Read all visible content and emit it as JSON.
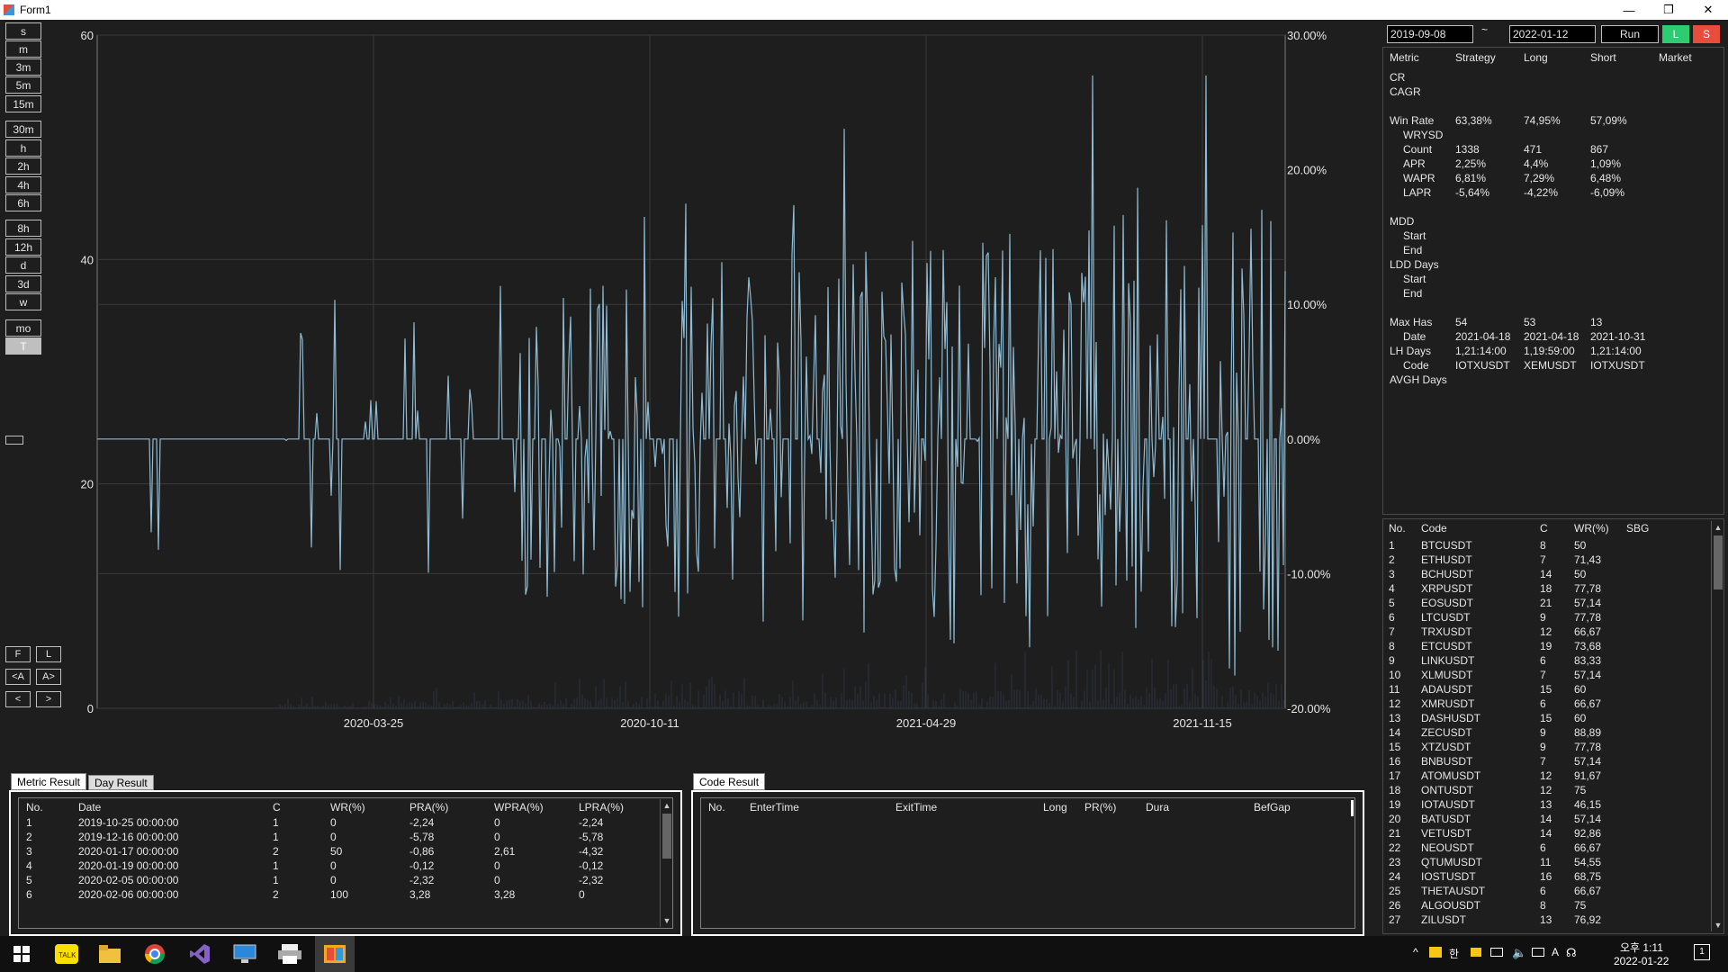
{
  "window": {
    "title": "Form1",
    "min": "—",
    "max": "❐",
    "close": "✕"
  },
  "timeframes": [
    "s",
    "m",
    "3m",
    "5m",
    "15m",
    "30m",
    "h",
    "2h",
    "4h",
    "6h",
    "8h",
    "12h",
    "d",
    "3d",
    "w",
    "mo",
    "T"
  ],
  "nav_buttons": {
    "f": "F",
    "l": "L",
    "prev": "<A",
    "next": "A>",
    "left": "<",
    "right": ">"
  },
  "chart_data": {
    "type": "line",
    "left_axis": {
      "ticks": [
        "60",
        "40",
        "20",
        "0"
      ],
      "ylim": [
        0,
        60
      ]
    },
    "right_axis": {
      "ticks": [
        "30.00%",
        "20.00%",
        "10.00%",
        "0.00%",
        "-10.00%",
        "-20.00%"
      ],
      "ylim": [
        -20,
        30
      ]
    },
    "x_ticks": [
      "2020-03-25",
      "2020-10-11",
      "2021-04-29",
      "2021-11-15"
    ],
    "series": [
      {
        "color": "#8fbcd4"
      }
    ],
    "grid": true
  },
  "controls": {
    "start_date": "2019-09-08",
    "tilde": "~",
    "end_date": "2022-01-12",
    "run": "Run",
    "long": "L",
    "short": "S"
  },
  "metrics": {
    "headers": [
      "Metric",
      "Strategy",
      "Long",
      "Short",
      "Market"
    ],
    "rows": [
      {
        "label": "CR",
        "indent": 0,
        "s": "",
        "l": "",
        "sh": ""
      },
      {
        "label": "CAGR",
        "indent": 0,
        "s": "",
        "l": "",
        "sh": ""
      },
      {
        "label": "",
        "indent": 0,
        "s": "",
        "l": "",
        "sh": ""
      },
      {
        "label": "Win Rate",
        "indent": 0,
        "s": "63,38%",
        "l": "74,95%",
        "sh": "57,09%"
      },
      {
        "label": "WRYSD",
        "indent": 1,
        "s": "",
        "l": "",
        "sh": ""
      },
      {
        "label": "Count",
        "indent": 1,
        "s": "1338",
        "l": "471",
        "sh": "867"
      },
      {
        "label": "APR",
        "indent": 1,
        "s": "2,25%",
        "l": "4,4%",
        "sh": "1,09%"
      },
      {
        "label": "WAPR",
        "indent": 1,
        "s": "6,81%",
        "l": "7,29%",
        "sh": "6,48%"
      },
      {
        "label": "LAPR",
        "indent": 1,
        "s": "-5,64%",
        "l": "-4,22%",
        "sh": "-6,09%"
      },
      {
        "label": "",
        "indent": 0,
        "s": "",
        "l": "",
        "sh": ""
      },
      {
        "label": "MDD",
        "indent": 0,
        "s": "",
        "l": "",
        "sh": ""
      },
      {
        "label": "Start",
        "indent": 1,
        "s": "",
        "l": "",
        "sh": ""
      },
      {
        "label": "End",
        "indent": 1,
        "s": "",
        "l": "",
        "sh": ""
      },
      {
        "label": "LDD Days",
        "indent": 0,
        "s": "",
        "l": "",
        "sh": ""
      },
      {
        "label": "Start",
        "indent": 1,
        "s": "",
        "l": "",
        "sh": ""
      },
      {
        "label": "End",
        "indent": 1,
        "s": "",
        "l": "",
        "sh": ""
      },
      {
        "label": "",
        "indent": 0,
        "s": "",
        "l": "",
        "sh": ""
      },
      {
        "label": "Max Has",
        "indent": 0,
        "s": "54",
        "l": "53",
        "sh": "13"
      },
      {
        "label": "Date",
        "indent": 1,
        "s": "2021-04-18",
        "l": "2021-04-18",
        "sh": "2021-10-31"
      },
      {
        "label": "LH Days",
        "indent": 0,
        "s": "1,21:14:00",
        "l": "1,19:59:00",
        "sh": "1,21:14:00"
      },
      {
        "label": "Code",
        "indent": 1,
        "s": "IOTXUSDT",
        "l": "XEMUSDT",
        "sh": "IOTXUSDT"
      },
      {
        "label": "AVGH Days",
        "indent": 0,
        "s": "",
        "l": "",
        "sh": ""
      }
    ]
  },
  "codes": {
    "headers": [
      "No.",
      "Code",
      "C",
      "WR(%)",
      "SBG"
    ],
    "rows": [
      [
        "1",
        "BTCUSDT",
        "8",
        "50"
      ],
      [
        "2",
        "ETHUSDT",
        "7",
        "71,43"
      ],
      [
        "3",
        "BCHUSDT",
        "14",
        "50"
      ],
      [
        "4",
        "XRPUSDT",
        "18",
        "77,78"
      ],
      [
        "5",
        "EOSUSDT",
        "21",
        "57,14"
      ],
      [
        "6",
        "LTCUSDT",
        "9",
        "77,78"
      ],
      [
        "7",
        "TRXUSDT",
        "12",
        "66,67"
      ],
      [
        "8",
        "ETCUSDT",
        "19",
        "73,68"
      ],
      [
        "9",
        "LINKUSDT",
        "6",
        "83,33"
      ],
      [
        "10",
        "XLMUSDT",
        "7",
        "57,14"
      ],
      [
        "11",
        "ADAUSDT",
        "15",
        "60"
      ],
      [
        "12",
        "XMRUSDT",
        "6",
        "66,67"
      ],
      [
        "13",
        "DASHUSDT",
        "15",
        "60"
      ],
      [
        "14",
        "ZECUSDT",
        "9",
        "88,89"
      ],
      [
        "15",
        "XTZUSDT",
        "9",
        "77,78"
      ],
      [
        "16",
        "BNBUSDT",
        "7",
        "57,14"
      ],
      [
        "17",
        "ATOMUSDT",
        "12",
        "91,67"
      ],
      [
        "18",
        "ONTUSDT",
        "12",
        "75"
      ],
      [
        "19",
        "IOTAUSDT",
        "13",
        "46,15"
      ],
      [
        "20",
        "BATUSDT",
        "14",
        "57,14"
      ],
      [
        "21",
        "VETUSDT",
        "14",
        "92,86"
      ],
      [
        "22",
        "NEOUSDT",
        "6",
        "66,67"
      ],
      [
        "23",
        "QTUMUSDT",
        "11",
        "54,55"
      ],
      [
        "24",
        "IOSTUSDT",
        "16",
        "68,75"
      ],
      [
        "25",
        "THETAUSDT",
        "6",
        "66,67"
      ],
      [
        "26",
        "ALGOUSDT",
        "8",
        "75"
      ],
      [
        "27",
        "ZILUSDT",
        "13",
        "76,92"
      ]
    ],
    "scroll_up": "▲",
    "scroll_down": "▼"
  },
  "metric_result": {
    "tabs": [
      "Metric Result",
      "Day Result"
    ],
    "headers": [
      "No.",
      "Date",
      "C",
      "WR(%)",
      "PRA(%)",
      "WPRA(%)",
      "LPRA(%)"
    ],
    "rows": [
      [
        "1",
        "2019-10-25 00:00:00",
        "1",
        "0",
        "-2,24",
        "0",
        "-2,24"
      ],
      [
        "2",
        "2019-12-16 00:00:00",
        "1",
        "0",
        "-5,78",
        "0",
        "-5,78"
      ],
      [
        "3",
        "2020-01-17 00:00:00",
        "2",
        "50",
        "-0,86",
        "2,61",
        "-4,32"
      ],
      [
        "4",
        "2020-01-19 00:00:00",
        "1",
        "0",
        "-0,12",
        "0",
        "-0,12"
      ],
      [
        "5",
        "2020-02-05 00:00:00",
        "1",
        "0",
        "-2,32",
        "0",
        "-2,32"
      ],
      [
        "6",
        "2020-02-06 00:00:00",
        "2",
        "100",
        "3,28",
        "3,28",
        "0"
      ]
    ],
    "scroll_up": "▲",
    "scroll_down": "▼"
  },
  "code_result": {
    "tab": "Code Result",
    "headers": [
      "No.",
      "EnterTime",
      "ExitTime",
      "Long",
      "PR(%)",
      "Dura",
      "BefGap"
    ]
  },
  "taskbar": {
    "icons": [
      "windows-start",
      "kakaotalk",
      "file-explorer",
      "chrome",
      "visual-studio",
      "remote-desktop",
      "printer",
      "form-app"
    ],
    "tray_text": "오후 1:11",
    "date": "2022-01-22",
    "tray_chevron": "^",
    "lang_ko": "한",
    "lang_a": "A"
  }
}
